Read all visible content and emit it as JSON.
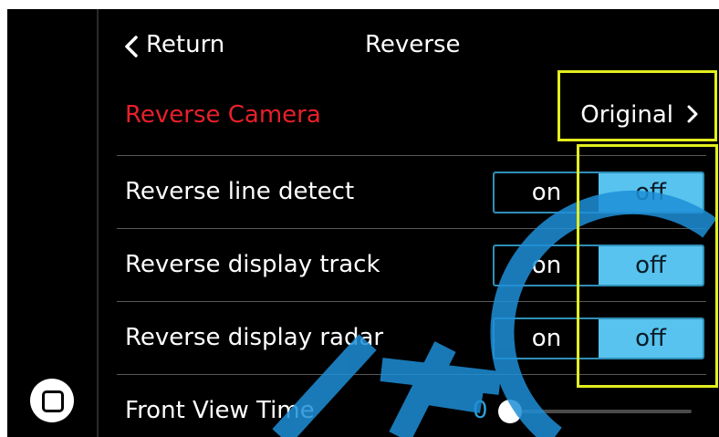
{
  "header": {
    "return_label": "Return",
    "title": "Reverse"
  },
  "reverse_camera": {
    "label": "Reverse Camera",
    "value": "Original"
  },
  "settings": [
    {
      "label": "Reverse line detect",
      "on_label": "on",
      "off_label": "off",
      "state": "off"
    },
    {
      "label": "Reverse display track",
      "on_label": "on",
      "off_label": "off",
      "state": "off"
    },
    {
      "label": "Reverse display radar",
      "on_label": "on",
      "off_label": "off",
      "state": "off"
    }
  ],
  "front_view_time": {
    "label": "Front View Time",
    "value": "0"
  },
  "colors": {
    "accent": "#57c3ee",
    "camera_label": "#e8202a",
    "highlight": "#e3ee1e",
    "slider_value": "#2e9ed8"
  },
  "icons": {
    "back": "chevron-left-icon",
    "forward": "chevron-right-icon",
    "home": "home-icon"
  }
}
